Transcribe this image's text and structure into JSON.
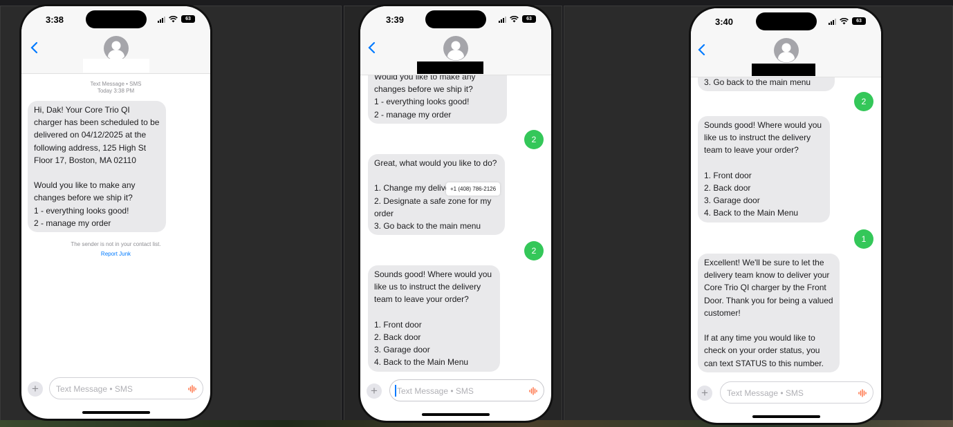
{
  "screens": [
    {
      "time": "3:38",
      "battery": "63",
      "thread_meta": {
        "type": "Text Message • SMS",
        "date": "Today 3:38 PM"
      },
      "messages": [
        {
          "from": "received",
          "text": "Hi, Dak! Your Core Trio QI charger has been scheduled to be delivered on 04/12/2025 at the following address, 125 High St Floor 17, Boston, MA 02110\n\nWould you like to make any changes before we ship it?\n1 - everything looks good!\n2 - manage my order"
        }
      ],
      "junk_note": "The sender is not in your contact list.",
      "junk_link": "Report Junk",
      "composer_placeholder": "Text Message • SMS"
    },
    {
      "time": "3:39",
      "battery": "63",
      "messages": [
        {
          "from": "received",
          "text": "Would you like to make any\nchanges before we ship it?\n1 - everything looks good!\n2 - manage my order"
        },
        {
          "from": "sent",
          "text": "2"
        },
        {
          "from": "received",
          "text": "Great, what would you like to do?\n\n1. Change my delive\n2. Designate a safe zone for my order\n3. Go back to the main menu"
        },
        {
          "from": "sent",
          "text": "2"
        },
        {
          "from": "received",
          "text": "Sounds good! Where would you like us to instruct the delivery team to leave your order?\n\n1. Front door\n2. Back door\n3. Garage door\n4. Back to the Main Menu"
        }
      ],
      "popover_phone": "+1 (408) 786-2126",
      "composer_placeholder": "Text Message • SMS"
    },
    {
      "time": "3:40",
      "battery": "63",
      "messages": [
        {
          "from": "received",
          "text": "3. Go back to the main menu"
        },
        {
          "from": "sent",
          "text": "2"
        },
        {
          "from": "received",
          "text": "Sounds good! Where would you like us to instruct the delivery team to leave your order?\n\n1. Front door\n2. Back door\n3. Garage door\n4. Back to the Main Menu"
        },
        {
          "from": "sent",
          "text": "1"
        },
        {
          "from": "received",
          "text": "Excellent! We'll be sure to let the delivery team know to deliver your Core Trio QI charger by the Front Door. Thank you for being a valued customer!\n\nIf at any time you would like to check on your order status, you can text STATUS to this number."
        }
      ],
      "composer_placeholder": "Text Message • SMS"
    }
  ],
  "colors": {
    "sent_bubble": "#34c759",
    "received_bubble": "#e9e9eb",
    "link": "#007aff"
  }
}
